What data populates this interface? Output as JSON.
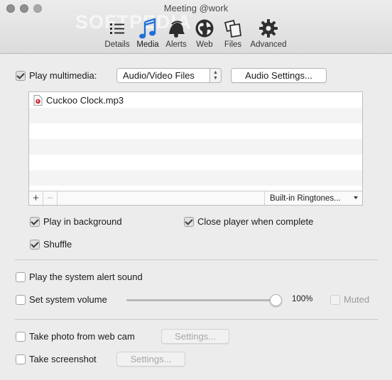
{
  "window": {
    "title": "Meeting @work",
    "watermark": "SOFTPEDIA"
  },
  "toolbar": {
    "items": [
      {
        "label": "Details",
        "icon": "list-icon"
      },
      {
        "label": "Media",
        "icon": "music-note-icon",
        "active": true
      },
      {
        "label": "Alerts",
        "icon": "alert-bell-icon"
      },
      {
        "label": "Web",
        "icon": "globe-icon"
      },
      {
        "label": "Files",
        "icon": "files-icon"
      },
      {
        "label": "Advanced",
        "icon": "gear-icon"
      }
    ],
    "active_color": "#1d6fd8"
  },
  "media": {
    "play_multimedia_label": "Play multimedia:",
    "play_multimedia_checked": true,
    "source_select_value": "Audio/Video Files",
    "audio_settings_label": "Audio Settings...",
    "files": [
      {
        "name": "Cuckoo Clock.mp3",
        "icon": "audio-file-icon"
      }
    ],
    "add_label": "+",
    "remove_label": "−",
    "ringtones_label": "Built-in Ringtones...",
    "play_background_label": "Play in background",
    "play_background_checked": true,
    "close_player_label": "Close player when complete",
    "close_player_checked": true,
    "shuffle_label": "Shuffle",
    "shuffle_checked": true
  },
  "alert": {
    "system_sound_label": "Play the system alert sound",
    "system_sound_checked": false,
    "set_volume_label": "Set system volume",
    "set_volume_checked": false,
    "volume_level": 1.0,
    "volume_text": "100%",
    "muted_label": "Muted",
    "muted_checked": false
  },
  "capture": {
    "webcam_label": "Take photo from web cam",
    "webcam_checked": false,
    "webcam_settings_label": "Settings...",
    "screenshot_label": "Take screenshot",
    "screenshot_checked": false,
    "screenshot_settings_label": "Settings..."
  }
}
